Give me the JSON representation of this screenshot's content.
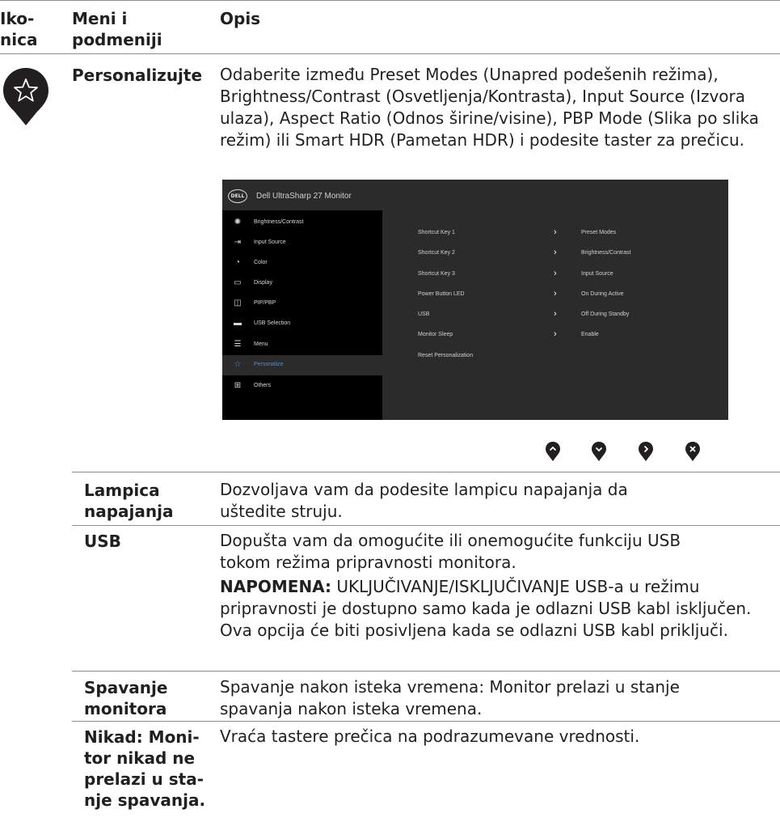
{
  "headers": {
    "icon_col": "Iko-\nnica",
    "menu_col": "Meni i\npodmeniji",
    "desc_col": "Opis"
  },
  "personalize": {
    "name": "Personalizujte",
    "description": "Odaberite između Preset Modes (Unapred podešenih režima), Brightness/Contrast (Osvetljenja/Kontrasta), Input Source (Izvora ulaza), Aspect Ratio (Odnos širine/visine), PBP Mode (Slika po slika režim) ili  Smart HDR (Pametan HDR) i podesite taster za prečicu."
  },
  "osd": {
    "logo": "DELL",
    "title": "Dell UltraSharp 27 Monitor",
    "menu": [
      {
        "icon": "brightness-icon",
        "glyph": "✺",
        "label": "Brightness/Contrast"
      },
      {
        "icon": "input-source-icon",
        "glyph": "⇥",
        "label": "Input Source"
      },
      {
        "icon": "color-icon",
        "glyph": "◔",
        "label": "Color"
      },
      {
        "icon": "display-icon",
        "glyph": "▭",
        "label": "Display"
      },
      {
        "icon": "pip-pbp-icon",
        "glyph": "◫",
        "label": "PIP/PBP"
      },
      {
        "icon": "usb-selection-icon",
        "glyph": "▬",
        "label": "USB Selection"
      },
      {
        "icon": "menu-icon",
        "glyph": "☰",
        "label": "Menu"
      },
      {
        "icon": "star-icon",
        "glyph": "☆",
        "label": "Personalize",
        "active": true
      },
      {
        "icon": "others-icon",
        "glyph": "⊞",
        "label": "Others"
      }
    ],
    "rows": [
      {
        "key": "Shortcut Key 1",
        "value": "Preset Modes"
      },
      {
        "key": "Shortcut Key 2",
        "value": "Brightness/Contrast"
      },
      {
        "key": "Shortcut Key 3",
        "value": "Input Source"
      },
      {
        "key": "Power Button LED",
        "value": "On During Active"
      },
      {
        "key": "USB",
        "value": "Off During Standby"
      },
      {
        "key": "Monitor Sleep",
        "value": "Enable"
      },
      {
        "key": "Reset Personalization",
        "value": ""
      }
    ]
  },
  "nav_buttons": [
    "up-icon",
    "down-icon",
    "right-icon",
    "close-icon"
  ],
  "rows": [
    {
      "name": "Lampica napajanja",
      "desc": "Dozvoljava vam da podesite lampicu napajanja da uštedite struju."
    },
    {
      "name": "USB",
      "desc": "Dopušta vam da omogućite ili onemogućite funkciju USB tokom režima pripravnosti monitora.",
      "note_label": "NAPOMENA:",
      "note": " UKLJUČIVANJE/ISKLJUČIVANJE USB-a u režimu pripravnosti je dostupno samo kada je odlazni USB kabl isključen. Ova opcija će biti posivljena kada se odlazni USB kabl priključi."
    },
    {
      "name": "Spavanje monitora",
      "desc": "Spavanje nakon isteka vremena: Monitor prelazi u stanje spavanja nakon isteka vremena."
    },
    {
      "name": "Nikad: Monitor nikad ne prelazi u stanje spavanja.",
      "desc": "Vraća tastere prečica na podrazumevane vrednosti."
    }
  ],
  "colors": {
    "text": "#231f20",
    "rule": "#8c8c8c",
    "osd_bg": "#2b2b2b",
    "osd_left": "#000000",
    "accent": "#4c8fd6"
  }
}
